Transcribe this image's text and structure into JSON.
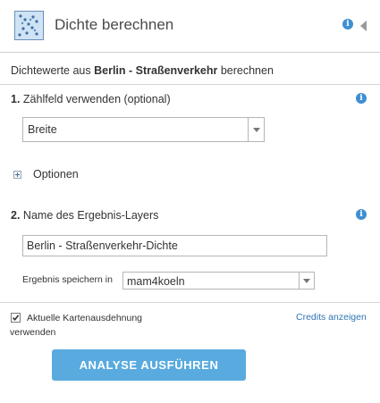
{
  "header": {
    "title": "Dichte berechnen",
    "tool_icon": "density-tool-icon",
    "info_icon": "info-icon",
    "collapse_icon": "collapse-arrow-icon"
  },
  "description": {
    "prefix": "Dichtewerte aus ",
    "layer": "Berlin - Straßenverkehr",
    "suffix": " berechnen"
  },
  "step1": {
    "number": "1.",
    "label": "Zählfeld verwenden (optional)",
    "selected_value": "Breite"
  },
  "options": {
    "label": "Optionen"
  },
  "step2": {
    "number": "2.",
    "label": "Name des Ergebnis-Layers",
    "layer_name_value": "Berlin - Straßenverkehr-Dichte"
  },
  "save": {
    "label": "Ergebnis speichern in",
    "folder_value": "mam4koeln"
  },
  "extent": {
    "checked": true,
    "label_line1": "Aktuelle Kartenausdehnung",
    "label_line2": "verwenden"
  },
  "credits": {
    "link_text": "Credits anzeigen"
  },
  "run_button": {
    "label": "ANALYSE AUSFÜHREN"
  },
  "colors": {
    "accent_button": "#59abdf",
    "info_icon": "#3f8fd2",
    "link": "#2f74b5"
  }
}
